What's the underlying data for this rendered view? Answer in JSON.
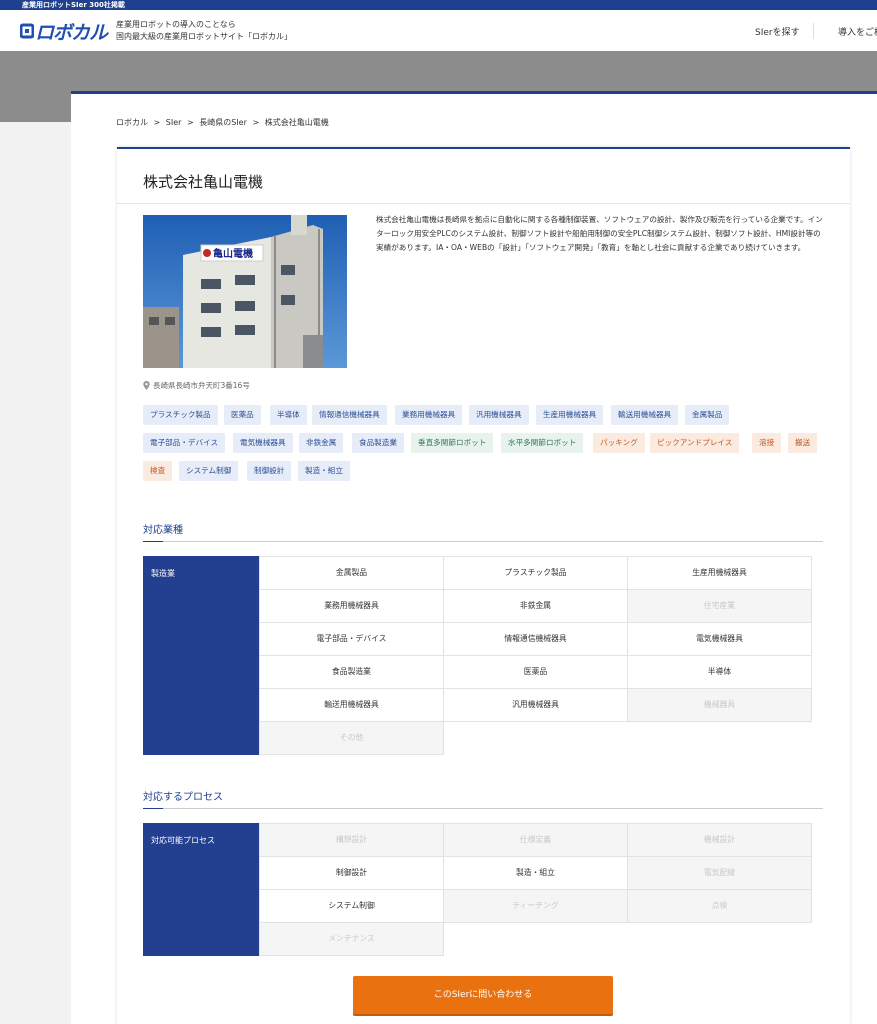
{
  "topbar": {
    "text": "産業用ロボットSIer 300社掲載"
  },
  "header": {
    "logo": "ロボカル",
    "tagline_line1": "産業用ロボットの導入のことなら",
    "tagline_line2": "国内最大級の産業用ロボットサイト「ロボカル」",
    "nav_find": "SIerを探す",
    "nav_intro": "導入をご検"
  },
  "breadcrumb": [
    "ロボカル",
    ">",
    "SIer",
    ">",
    "長崎県のSIer",
    ">",
    "株式会社亀山電機"
  ],
  "company": {
    "name": "株式会社亀山電機",
    "description": "株式会社亀山電機は長崎県を拠点に自動化に関する各種制御装置、ソフトウェアの設計、製作及び販売を行っている企業です。インターロック用安全PLCのシステム設計、制御ソフト設計や船舶用制御の安全PLC制御システム設計、制御ソフト設計、HMI設計等の実績があります。IA・OA・WEBの「設計」「ソフトウェア開発」「教育」を軸とし社会に貢献する企業であり続けていきます。",
    "address": "長崎県長崎市弁天町3番16号",
    "sign_text": "亀山電機"
  },
  "tags": [
    {
      "label": "プラスチック製品",
      "kind": "blue"
    },
    {
      "label": "医薬品",
      "kind": "blue"
    },
    {
      "label": "半導体",
      "kind": "blue"
    },
    {
      "label": "情報通信機械器具",
      "kind": "blue"
    },
    {
      "label": "業務用機械器具",
      "kind": "blue"
    },
    {
      "label": "汎用機械器具",
      "kind": "blue"
    },
    {
      "label": "生産用機械器具",
      "kind": "blue"
    },
    {
      "label": "輸送用機械器具",
      "kind": "blue"
    },
    {
      "label": "金属製品",
      "kind": "blue"
    },
    {
      "label": "電子部品・デバイス",
      "kind": "blue"
    },
    {
      "label": "電気機械器具",
      "kind": "blue"
    },
    {
      "label": "非鉄金属",
      "kind": "blue"
    },
    {
      "label": "食品製造業",
      "kind": "blue"
    },
    {
      "label": "垂直多関節ロボット",
      "kind": "green"
    },
    {
      "label": "水平多関節ロボット",
      "kind": "green"
    },
    {
      "label": "パッキング",
      "kind": "orange"
    },
    {
      "label": "ピックアンドプレイス",
      "kind": "orange"
    },
    {
      "label": "溶接",
      "kind": "orange"
    },
    {
      "label": "搬送",
      "kind": "orange"
    },
    {
      "label": "検査",
      "kind": "orange"
    },
    {
      "label": "システム制御",
      "kind": "blue"
    },
    {
      "label": "制御設計",
      "kind": "blue"
    },
    {
      "label": "製造・組立",
      "kind": "blue"
    }
  ],
  "industries": {
    "heading": "対応業種",
    "label": "製造業",
    "cells": [
      {
        "text": "金属製品",
        "on": true
      },
      {
        "text": "プラスチック製品",
        "on": true
      },
      {
        "text": "生産用機械器具",
        "on": true
      },
      {
        "text": "業務用機械器具",
        "on": true
      },
      {
        "text": "非鉄金属",
        "on": true
      },
      {
        "text": "住宅産業",
        "on": false
      },
      {
        "text": "電子部品・デバイス",
        "on": true
      },
      {
        "text": "情報通信機械器具",
        "on": true
      },
      {
        "text": "電気機械器具",
        "on": true
      },
      {
        "text": "食品製造業",
        "on": true
      },
      {
        "text": "医薬品",
        "on": true
      },
      {
        "text": "半導体",
        "on": true
      },
      {
        "text": "輸送用機械器具",
        "on": true
      },
      {
        "text": "汎用機械器具",
        "on": true
      },
      {
        "text": "機械器具",
        "on": false
      },
      {
        "text": "その他",
        "on": false
      }
    ]
  },
  "processes": {
    "heading": "対応するプロセス",
    "label": "対応可能プロセス",
    "cells": [
      {
        "text": "構想設計",
        "on": false
      },
      {
        "text": "仕様定義",
        "on": false
      },
      {
        "text": "機械設計",
        "on": false
      },
      {
        "text": "制御設計",
        "on": true
      },
      {
        "text": "製造・組立",
        "on": true
      },
      {
        "text": "電気配線",
        "on": false
      },
      {
        "text": "システム制御",
        "on": true
      },
      {
        "text": "ティーチング",
        "on": false
      },
      {
        "text": "点検",
        "on": false
      },
      {
        "text": "メンテナンス",
        "on": false
      }
    ]
  },
  "cta": {
    "label": "このSIerに問い合わせる"
  },
  "colors": {
    "brand": "#1f3f8f",
    "cta": "#e9710f",
    "label_bg": "#233f8f"
  }
}
